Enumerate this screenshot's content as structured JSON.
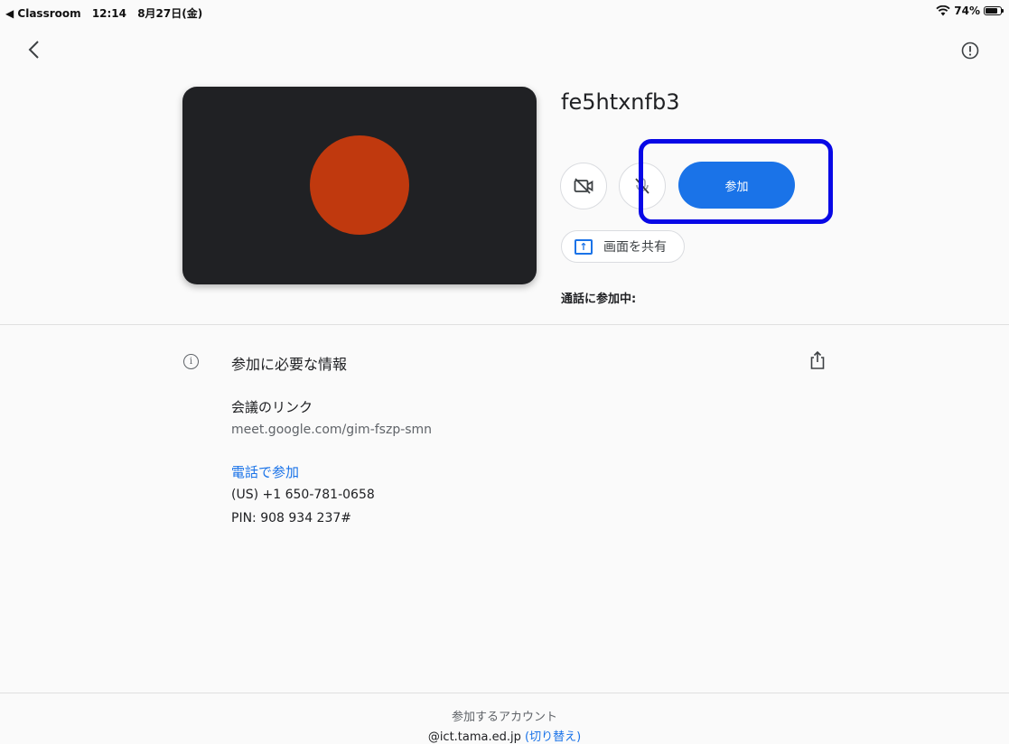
{
  "status_bar": {
    "back_app": "◀ Classroom",
    "time": "12:14",
    "date": "8月27日(金)",
    "battery": "74%"
  },
  "icons": {
    "back": "chevron-left-icon",
    "report": "alert-circle-icon",
    "camera_off": "camera-off-icon",
    "mic_off": "mic-off-icon",
    "present": "present-screen-icon",
    "info": "info-icon",
    "share": "share-export-icon",
    "wifi": "wifi-icon",
    "battery": "battery-icon"
  },
  "meeting": {
    "title": "fe5htxnfb3",
    "join_label": "参加",
    "share_screen_label": "画面を共有",
    "in_call_label": "通話に参加中:"
  },
  "info": {
    "heading": "参加に必要な情報",
    "link_label": "会議のリンク",
    "link_url": "meet.google.com/gim-fszp-smn",
    "phone_label": "電話で参加",
    "phone_number": "(US) +1 650-781-0658",
    "pin": "PIN: 908 934 237#"
  },
  "footer": {
    "label": "参加するアカウント",
    "account": "@ict.tama.ed.jp",
    "paren_open": "(",
    "switch_label": "切り替え",
    "paren_close": ")"
  },
  "colors": {
    "accent": "#1a73e8",
    "avatar": "#c0390e",
    "preview_bg": "#202124",
    "highlight": "#0808e6"
  }
}
